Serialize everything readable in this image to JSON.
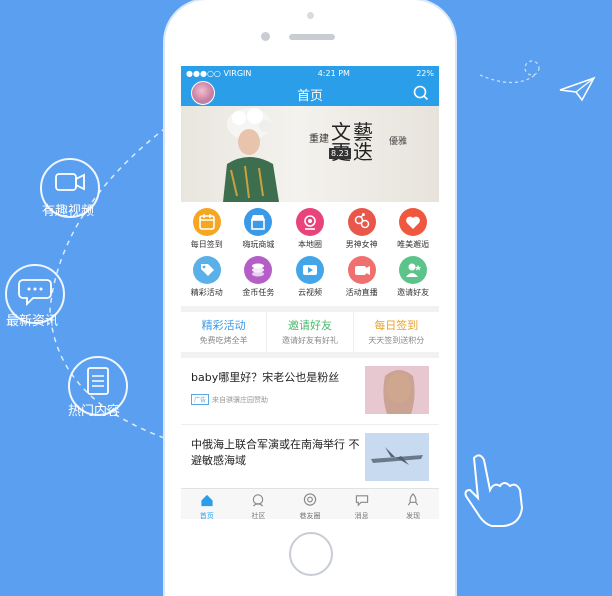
{
  "status": {
    "carrier": "●●●○○ VIRGIN",
    "time": "4:21 PM",
    "battery": "22%"
  },
  "nav": {
    "title": "首页"
  },
  "banner": {
    "line1": "重建",
    "big1": "文藝",
    "big2": "更迭",
    "side": "優雅",
    "date": "8.23"
  },
  "grid": [
    [
      {
        "label": "每日签到",
        "icon": "calendar-icon",
        "color": "#f5a623"
      },
      {
        "label": "嗨玩商城",
        "icon": "shop-icon",
        "color": "#3b9ae8"
      },
      {
        "label": "本地圈",
        "icon": "location-icon",
        "color": "#e8437a"
      },
      {
        "label": "男神女神",
        "icon": "gender-icon",
        "color": "#e8574a"
      },
      {
        "label": "唯美邂逅",
        "icon": "heart-icon",
        "color": "#f0573f"
      }
    ],
    [
      {
        "label": "精彩活动",
        "icon": "tag-icon",
        "color": "#5ab0e8"
      },
      {
        "label": "金币任务",
        "icon": "coins-icon",
        "color": "#b65ec8"
      },
      {
        "label": "云视频",
        "icon": "video-icon",
        "color": "#42a6e8"
      },
      {
        "label": "活动直播",
        "icon": "camera-icon",
        "color": "#f07070"
      },
      {
        "label": "邀请好友",
        "icon": "user-star-icon",
        "color": "#5cc48a"
      }
    ]
  ],
  "features": [
    {
      "title": "精彩活动",
      "sub": "免费吃烤全羊",
      "color": "#3b9ae8"
    },
    {
      "title": "邀请好友",
      "sub": "邀请好友有好礼",
      "color": "#4bb86e"
    },
    {
      "title": "每日签到",
      "sub": "天天签到送积分",
      "color": "#e8a22a"
    }
  ],
  "feed": [
    {
      "title": "baby哪里好？宋老公也是粉丝",
      "ad": "广告",
      "source": "来自骐骥庄园赞助"
    },
    {
      "title": "中俄海上联合军演或在南海举行 不避敏感海域"
    }
  ],
  "tabs": [
    {
      "label": "首页",
      "icon": "home-icon"
    },
    {
      "label": "社区",
      "icon": "community-icon"
    },
    {
      "label": "巷友圈",
      "icon": "circle-icon"
    },
    {
      "label": "消息",
      "icon": "message-icon"
    },
    {
      "label": "发现",
      "icon": "rocket-icon"
    }
  ],
  "side_features": [
    {
      "label": "有趣视频",
      "icon": "video-camera-icon"
    },
    {
      "label": "最新资讯",
      "icon": "chat-icon"
    },
    {
      "label": "热门内容",
      "icon": "list-icon"
    }
  ]
}
